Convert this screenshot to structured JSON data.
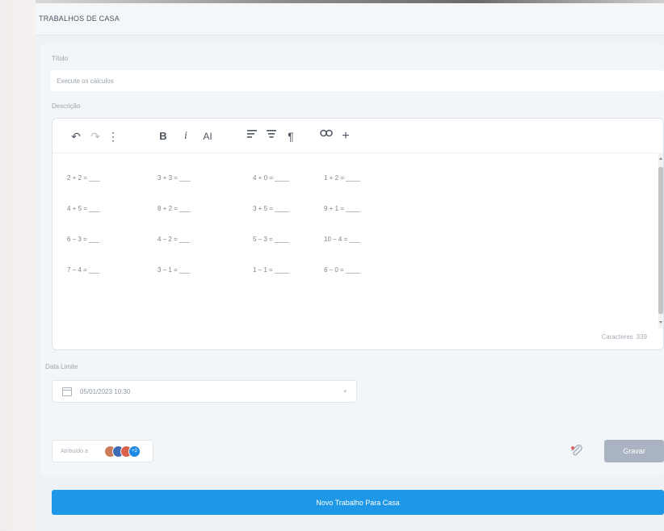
{
  "header": {
    "title": "TRABALHOS DE CASA"
  },
  "form": {
    "title_label": "Título",
    "title_value": "Execute os cálculos",
    "description_label": "Descrição",
    "toolbar": [
      {
        "icon": "undo-icon",
        "glyph": "↶",
        "dim": false
      },
      {
        "icon": "redo-icon",
        "glyph": "↷",
        "dim": true
      },
      {
        "icon": "more-vertical-icon",
        "glyph": "⋮",
        "dim": false
      },
      {
        "icon": "bold-icon",
        "glyph": "B",
        "dim": false
      },
      {
        "icon": "italic-icon",
        "glyph": "i",
        "dim": false
      },
      {
        "icon": "font-size-icon",
        "glyph": "AI",
        "dim": false
      },
      {
        "icon": "align-left-icon",
        "glyph": "",
        "dim": false
      },
      {
        "icon": "align-center-icon",
        "glyph": "",
        "dim": false
      },
      {
        "icon": "paragraph-icon",
        "glyph": "¶",
        "dim": false
      },
      {
        "icon": "link-icon",
        "glyph": "",
        "dim": false
      },
      {
        "icon": "insert-icon",
        "glyph": "+",
        "dim": false
      }
    ],
    "content_rows": [
      [
        "2 + 2 = ___",
        "3 + 3 = ___",
        "4 + 0 = ____",
        "1 + 2 = ____"
      ],
      [
        "4 + 5 = ___",
        "8 + 2 = ___",
        "3 + 5 = ____",
        "9 + 1 = ____"
      ],
      [
        "6 – 3 = ___",
        "4 – 2 = ___",
        "5 – 3 = ____",
        "10 – 4 = ___"
      ],
      [
        "7 – 4 = ___",
        "3 – 1 = ___",
        "1 – 1 = ____",
        "6 – 0 = ____"
      ]
    ],
    "char_label": "Caracteres",
    "char_count": "339",
    "deadline_label": "Data Limite",
    "deadline_value": "05/01/2023 10:30",
    "assigned_label": "Atribuído a",
    "assigned_extra": "+2",
    "save_label": "Gravar"
  },
  "new_button_label": "Novo Trabalho Para Casa",
  "colors": {
    "primary": "#1e97e6",
    "save_disabled": "#a9b3c2"
  }
}
